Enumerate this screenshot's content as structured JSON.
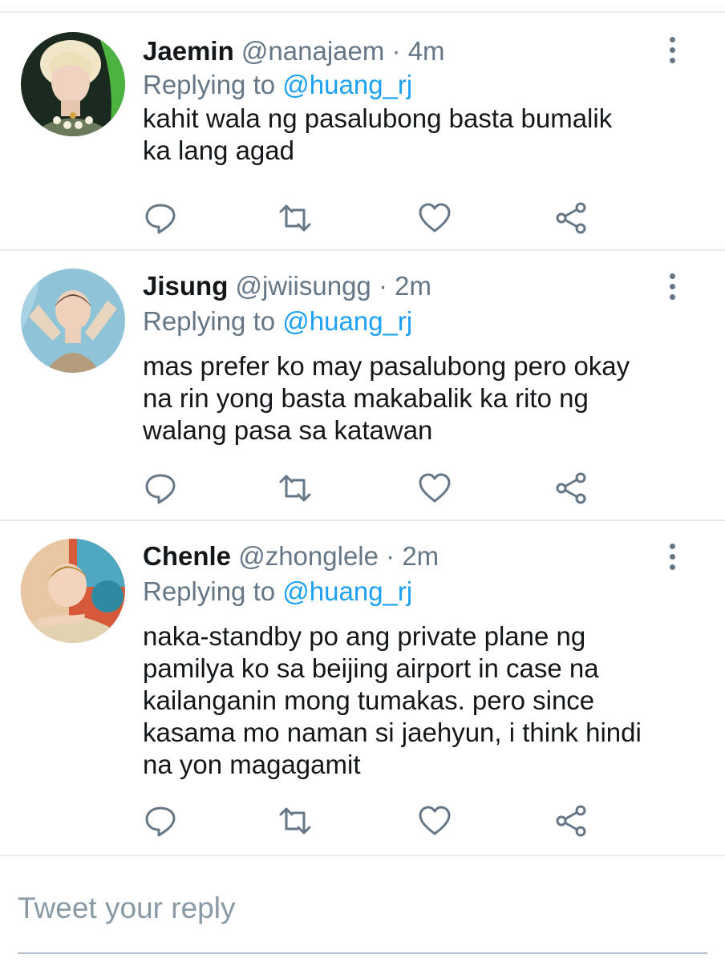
{
  "replies": [
    {
      "name": "Jaemin",
      "handle": "@nanajaem",
      "separator": "·",
      "time": "4m",
      "replying_prefix": "Replying to",
      "replying_to": "@huang_rj",
      "text_lines": [
        "kahit wala ng pasalubong basta bumalik",
        "ka lang agad"
      ],
      "avatar_icon": "avatar-jaemin"
    },
    {
      "name": "Jisung",
      "handle": "@jwiisungg",
      "separator": "·",
      "time": "2m",
      "replying_prefix": "Replying to",
      "replying_to": "@huang_rj",
      "text_lines": [
        "mas prefer ko may pasalubong pero okay",
        "na rin yong basta makabalik ka rito ng",
        "walang pasa sa katawan"
      ],
      "avatar_icon": "avatar-jisung"
    },
    {
      "name": "Chenle",
      "handle": "@zhonglele",
      "separator": "·",
      "time": "2m",
      "replying_prefix": "Replying to",
      "replying_to": "@huang_rj",
      "text_lines": [
        "naka-standby po ang private plane ng",
        "pamilya ko sa beijing airport in case na",
        "kailanganin mong tumakas. pero since",
        "kasama mo naman si jaehyun, i think hindi",
        "na yon magagamit"
      ],
      "avatar_icon": "avatar-chenle"
    }
  ],
  "actions": [
    "reply-icon",
    "retweet-icon",
    "like-icon",
    "share-icon"
  ],
  "compose": {
    "placeholder": "Tweet your reply"
  },
  "colors": {
    "link": "#1da1f2",
    "secondary": "#657786",
    "divider": "#e6ecf0"
  }
}
